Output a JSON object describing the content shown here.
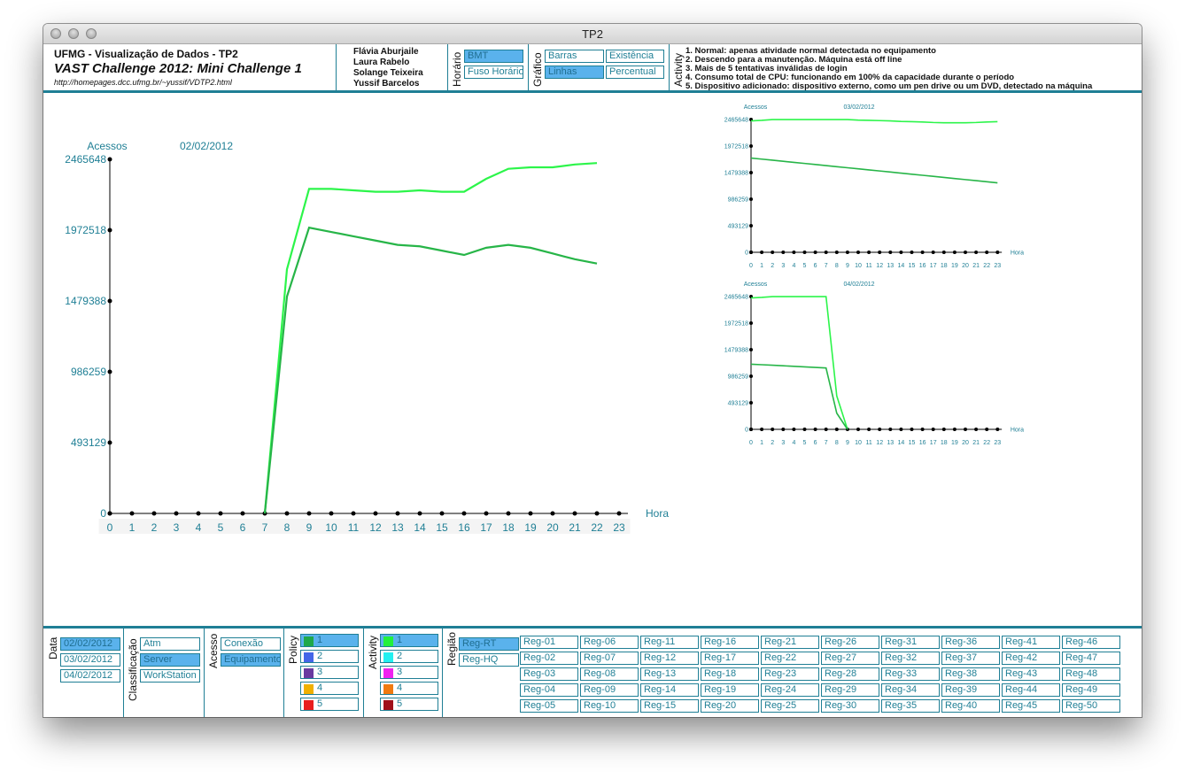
{
  "window": {
    "title": "TP2"
  },
  "header": {
    "title": "UFMG - Visualização de Dados - TP2",
    "subtitle": "VAST Challenge 2012: Mini Challenge 1",
    "url": "http://homepages.dcc.ufmg.br/~yussif/VDTP2.html",
    "authors": [
      "Flávia Aburjaile",
      "Laura Rabelo",
      "Solange Teixeira",
      "Yussif Barcelos"
    ],
    "horario": {
      "label": "Horário",
      "options": [
        {
          "label": "BMT",
          "selected": true
        },
        {
          "label": "Fuso Horário",
          "selected": false
        }
      ]
    },
    "grafico": {
      "label": "Gráfico",
      "options": [
        {
          "label": "Barras",
          "selected": false
        },
        {
          "label": "Existência",
          "selected": false
        },
        {
          "label": "Linhas",
          "selected": true
        },
        {
          "label": "Percentual",
          "selected": false
        }
      ]
    },
    "activity": {
      "label": "Activity",
      "lines": [
        "1. Normal: apenas atividade normal detectada no equipamento",
        "2. Descendo para a manutenção. Máquina está off line",
        "3. Mais de 5 tentativas inválidas de login",
        "4. Consumo total de CPU: funcionando em 100% da capacidade durante o período",
        "5. Dispositivo adicionado: dispositivo externo, como um pen drive ou um DVD, detectado na máquina"
      ]
    }
  },
  "colors": {
    "accent": "#1f7f95",
    "selected": "#5ab2ec",
    "line_light": "#2cf54a",
    "line_dark": "#27b548"
  },
  "chart_data": [
    {
      "type": "line",
      "title": "02/02/2012",
      "ylabel": "Acessos",
      "xlabel": "Hora",
      "x": [
        0,
        1,
        2,
        3,
        4,
        5,
        6,
        7,
        8,
        9,
        10,
        11,
        12,
        13,
        14,
        15,
        16,
        17,
        18,
        19,
        20,
        21,
        22,
        23
      ],
      "ylim": [
        0,
        2465648
      ],
      "yticks": [
        "0",
        "493129",
        "986259",
        "1479388",
        "1972518",
        "2465648"
      ],
      "series": [
        {
          "color": "#2cf54a",
          "start": 7,
          "values": [
            0,
            1700000,
            2260000,
            2260000,
            2250000,
            2240000,
            2240000,
            2250000,
            2240000,
            2240000,
            2330000,
            2400000,
            2410000,
            2410000,
            2430000,
            2440000
          ]
        },
        {
          "color": "#27b548",
          "start": 7,
          "values": [
            0,
            1510000,
            1990000,
            1960000,
            1930000,
            1900000,
            1870000,
            1860000,
            1830000,
            1800000,
            1850000,
            1870000,
            1850000,
            1810000,
            1770000,
            1740000
          ]
        }
      ]
    },
    {
      "type": "line",
      "title": "03/02/2012",
      "ylabel": "Acessos",
      "xlabel": "Hora",
      "x": [
        0,
        1,
        2,
        3,
        4,
        5,
        6,
        7,
        8,
        9,
        10,
        11,
        12,
        13,
        14,
        15,
        16,
        17,
        18,
        19,
        20,
        21,
        22,
        23
      ],
      "ylim": [
        0,
        2465648
      ],
      "yticks": [
        "0",
        "493129",
        "986259",
        "1479388",
        "1972518",
        "2465648"
      ],
      "series": [
        {
          "color": "#2cf54a",
          "start": 0,
          "values": [
            2440000,
            2450000,
            2465000,
            2465000,
            2465000,
            2465000,
            2465000,
            2465000,
            2465000,
            2465000,
            2455000,
            2450000,
            2445000,
            2440000,
            2430000,
            2425000,
            2420000,
            2410000,
            2405000,
            2405000,
            2405000,
            2410000,
            2420000,
            2425000
          ]
        },
        {
          "color": "#27b548",
          "start": 0,
          "values": [
            1750000,
            1730000,
            1710000,
            1690000,
            1670000,
            1650000,
            1630000,
            1610000,
            1590000,
            1570000,
            1550000,
            1530000,
            1510000,
            1490000,
            1470000,
            1450000,
            1430000,
            1410000,
            1390000,
            1370000,
            1350000,
            1330000,
            1310000,
            1290000
          ]
        }
      ]
    },
    {
      "type": "line",
      "title": "04/02/2012",
      "ylabel": "Acessos",
      "xlabel": "Hora",
      "x": [
        0,
        1,
        2,
        3,
        4,
        5,
        6,
        7,
        8,
        9,
        10,
        11,
        12,
        13,
        14,
        15,
        16,
        17,
        18,
        19,
        20,
        21,
        22,
        23
      ],
      "ylim": [
        0,
        2465648
      ],
      "yticks": [
        "0",
        "493129",
        "986259",
        "1479388",
        "1972518",
        "2465648"
      ],
      "series": [
        {
          "color": "#2cf54a",
          "start": 0,
          "values": [
            2440000,
            2450000,
            2465000,
            2465000,
            2465000,
            2465000,
            2465000,
            2465000,
            620000,
            0
          ]
        },
        {
          "color": "#27b548",
          "start": 0,
          "values": [
            1210000,
            1200000,
            1190000,
            1180000,
            1170000,
            1160000,
            1150000,
            1140000,
            300000,
            0
          ]
        }
      ]
    }
  ],
  "filters": {
    "data": {
      "label": "Data",
      "options": [
        {
          "label": "02/02/2012",
          "selected": true
        },
        {
          "label": "03/02/2012",
          "selected": false
        },
        {
          "label": "04/02/2012",
          "selected": false
        }
      ]
    },
    "classificacao": {
      "label": "Classificação",
      "options": [
        {
          "label": "Atm",
          "selected": false
        },
        {
          "label": "Server",
          "selected": true
        },
        {
          "label": "WorkStation",
          "selected": false
        }
      ]
    },
    "acesso": {
      "label": "Acesso",
      "options": [
        {
          "label": "Conexão",
          "selected": false
        },
        {
          "label": "Equipamento",
          "selected": true
        }
      ]
    },
    "policy": {
      "label": "Policy",
      "options": [
        {
          "label": "1",
          "color": "#1fa84a",
          "selected": true
        },
        {
          "label": "2",
          "color": "#4466e8",
          "selected": false
        },
        {
          "label": "3",
          "color": "#6a3aa0",
          "selected": false
        },
        {
          "label": "4",
          "color": "#f0b000",
          "selected": false
        },
        {
          "label": "5",
          "color": "#e81e1e",
          "selected": false
        }
      ]
    },
    "activity": {
      "label": "Activity",
      "options": [
        {
          "label": "1",
          "color": "#22f03c",
          "selected": true
        },
        {
          "label": "2",
          "color": "#22f0f0",
          "selected": false
        },
        {
          "label": "3",
          "color": "#f022f0",
          "selected": false
        },
        {
          "label": "4",
          "color": "#f07a10",
          "selected": false
        },
        {
          "label": "5",
          "color": "#a0101a",
          "selected": false
        }
      ]
    },
    "regiao": {
      "label": "Região",
      "main": [
        {
          "label": "Reg-RT",
          "selected": true
        },
        {
          "label": "Reg-HQ",
          "selected": false
        }
      ],
      "regions": [
        "Reg-01",
        "Reg-02",
        "Reg-03",
        "Reg-04",
        "Reg-05",
        "Reg-06",
        "Reg-07",
        "Reg-08",
        "Reg-09",
        "Reg-10",
        "Reg-11",
        "Reg-12",
        "Reg-13",
        "Reg-14",
        "Reg-15",
        "Reg-16",
        "Reg-17",
        "Reg-18",
        "Reg-19",
        "Reg-20",
        "Reg-21",
        "Reg-22",
        "Reg-23",
        "Reg-24",
        "Reg-25",
        "Reg-26",
        "Reg-27",
        "Reg-28",
        "Reg-29",
        "Reg-30",
        "Reg-31",
        "Reg-32",
        "Reg-33",
        "Reg-34",
        "Reg-35",
        "Reg-36",
        "Reg-37",
        "Reg-38",
        "Reg-39",
        "Reg-40",
        "Reg-41",
        "Reg-42",
        "Reg-43",
        "Reg-44",
        "Reg-45",
        "Reg-46",
        "Reg-47",
        "Reg-48",
        "Reg-49",
        "Reg-50"
      ]
    }
  }
}
